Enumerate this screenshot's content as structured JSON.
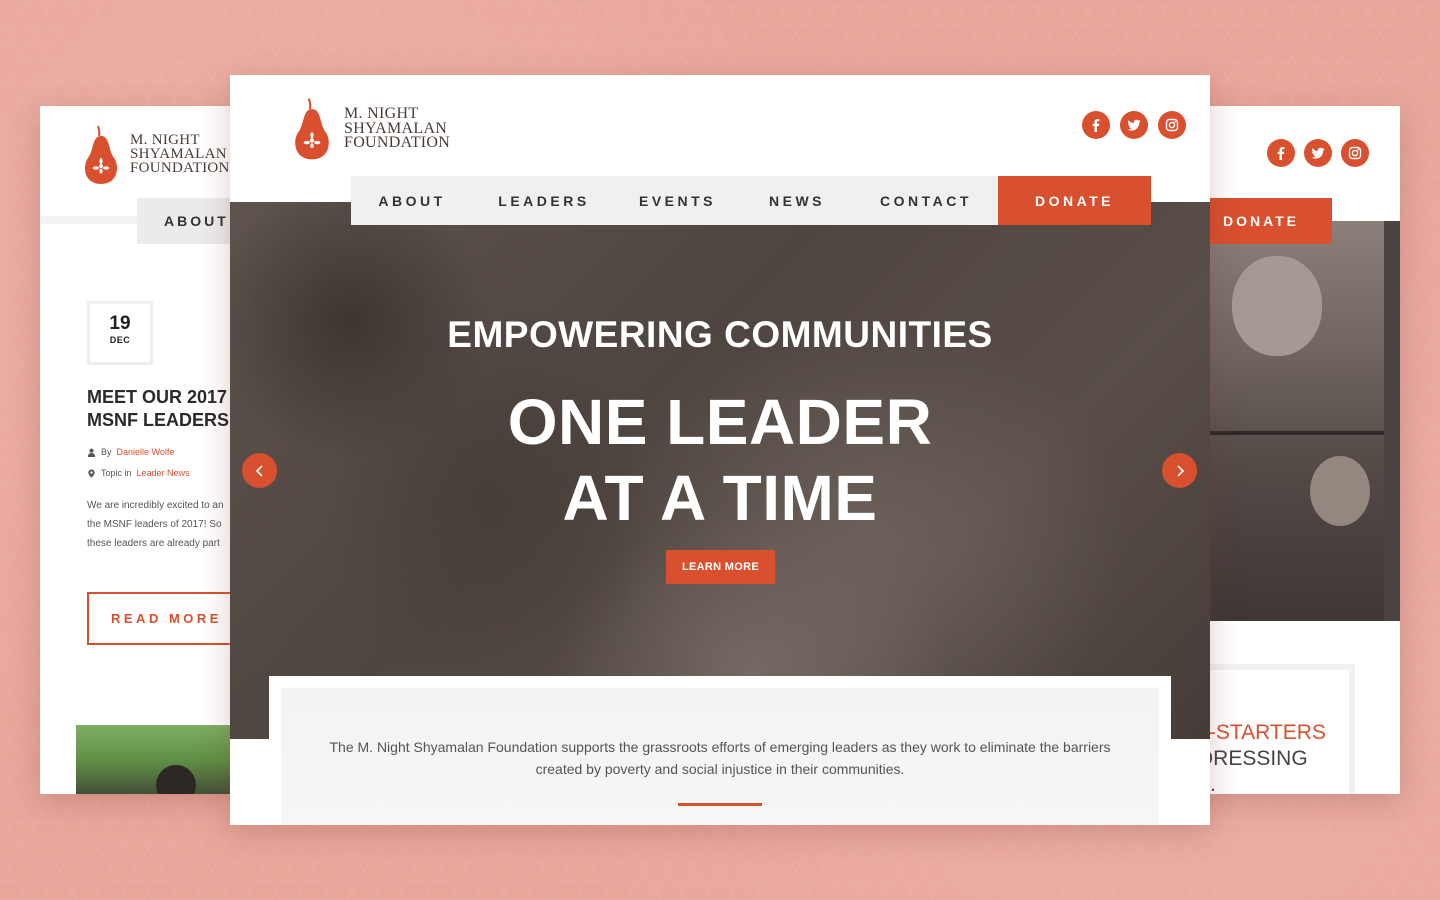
{
  "brand": {
    "logo_line1": "M. Night",
    "logo_line2": "Shyamalan",
    "logo_line3": "Foundation",
    "accent_color": "#d9502f"
  },
  "social": [
    "facebook-icon",
    "twitter-icon",
    "instagram-icon"
  ],
  "nav": {
    "items": [
      "ABOUT",
      "LEADERS",
      "EVENTS",
      "NEWS",
      "CONTACT"
    ],
    "donate": "DONATE"
  },
  "hero": {
    "subtitle": "EMPOWERING COMMUNITIES",
    "title_line1": "ONE LEADER",
    "title_line2": "AT A TIME",
    "cta": "LEARN MORE"
  },
  "intro": {
    "text": "The M. Night Shyamalan Foundation supports the grassroots efforts of emerging leaders as they work to eliminate the barriers created by poverty and social injustice in their communities."
  },
  "left_page": {
    "nav_about": "ABOUT",
    "date_day": "19",
    "date_month": "DEC",
    "post_title_line1": "MEET OUR 2017",
    "post_title_line2": "MSNF LEADERS",
    "author_prefix": "By",
    "author": "Danielle Wolfe",
    "topic_prefix": "Topic in",
    "topic": "Leader News",
    "excerpt": "We are incredibly excited to an\nthe MSNF leaders of 2017!  So\nthese leaders are already part",
    "read_more": "READ MORE"
  },
  "right_page": {
    "donate": "DONATE",
    "heading_line1": "F-STARTERS",
    "heading_line2": "DRESSING",
    "heading_line3": "S."
  }
}
